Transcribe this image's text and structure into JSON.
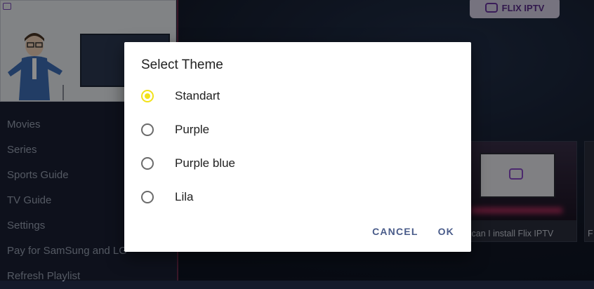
{
  "sidebar": {
    "items": [
      {
        "label": "Movies"
      },
      {
        "label": "Series"
      },
      {
        "label": "Sports Guide"
      },
      {
        "label": "TV Guide"
      },
      {
        "label": "Settings"
      },
      {
        "label": "Pay for SamSung and LG"
      },
      {
        "label": "Refresh Playlist"
      }
    ]
  },
  "header": {
    "brand": "FLIX IPTV"
  },
  "cards": [
    {
      "caption": "w can I install Flix IPTV"
    },
    {
      "caption": "F"
    }
  ],
  "dialog": {
    "title": "Select Theme",
    "options": [
      {
        "label": "Standart",
        "selected": true
      },
      {
        "label": "Purple",
        "selected": false
      },
      {
        "label": "Purple blue",
        "selected": false
      },
      {
        "label": "Lila",
        "selected": false
      }
    ],
    "cancel_label": "CANCEL",
    "ok_label": "OK"
  },
  "colors": {
    "accent_radio": "#f2e21a",
    "button_text": "#4a5c8a",
    "brand_purple": "#5a2d8a"
  }
}
